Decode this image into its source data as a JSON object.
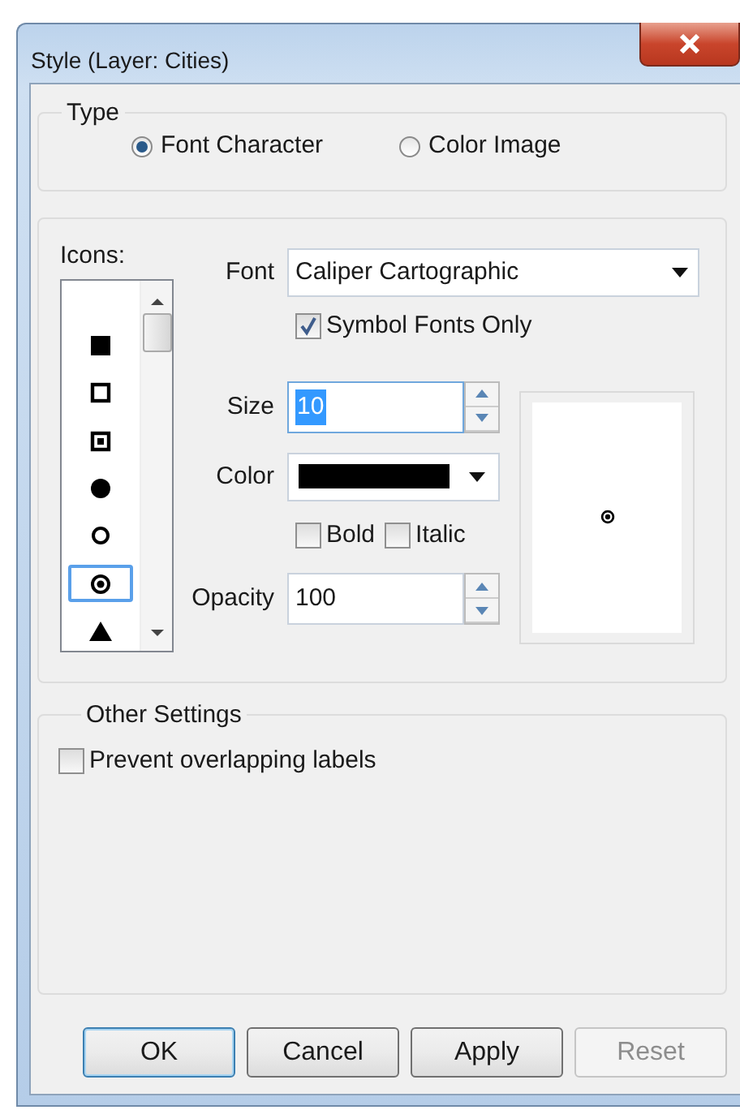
{
  "window": {
    "title": "Style (Layer: Cities)"
  },
  "type_group": {
    "title": "Type",
    "options": [
      {
        "label": "Font Character",
        "selected": true
      },
      {
        "label": "Color Image",
        "selected": false
      }
    ]
  },
  "icons_group": {
    "label": "Icons:",
    "icons": [
      {
        "kind": "filled-square",
        "selected": false
      },
      {
        "kind": "hollow-square",
        "selected": false
      },
      {
        "kind": "square-dot",
        "selected": false
      },
      {
        "kind": "filled-circle",
        "selected": false
      },
      {
        "kind": "hollow-circle",
        "selected": false
      },
      {
        "kind": "bullseye",
        "selected": true
      },
      {
        "kind": "triangle",
        "selected": false
      }
    ],
    "font": {
      "label": "Font",
      "value": "Caliper Cartographic"
    },
    "symbol_fonts_only": {
      "label": "Symbol Fonts Only",
      "checked": true
    },
    "size": {
      "label": "Size",
      "value": "10"
    },
    "color": {
      "label": "Color",
      "color": "#000000"
    },
    "bold": {
      "label": "Bold",
      "checked": false
    },
    "italic": {
      "label": "Italic",
      "checked": false
    },
    "opacity": {
      "label": "Opacity",
      "value": "100"
    }
  },
  "other_settings": {
    "title": "Other Settings",
    "prevent_overlapping": {
      "label": "Prevent overlapping labels",
      "checked": false
    }
  },
  "buttons": [
    {
      "label": "OK",
      "default": true,
      "disabled": false
    },
    {
      "label": "Cancel",
      "default": false,
      "disabled": false
    },
    {
      "label": "Apply",
      "default": false,
      "disabled": false
    },
    {
      "label": "Reset",
      "default": false,
      "disabled": true
    }
  ]
}
